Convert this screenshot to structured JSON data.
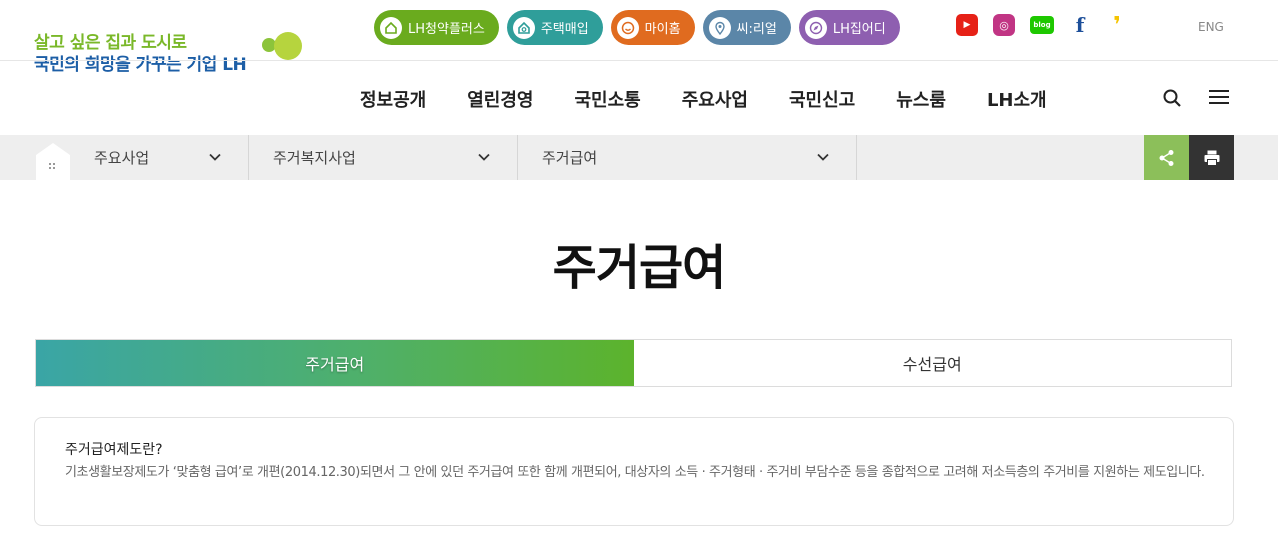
{
  "logo": {
    "line1": "살고 싶은 집과 도시로",
    "line2": "국민의 희망을 가꾸는 기업 LH"
  },
  "quick_links": [
    {
      "label": "LH청약플러스",
      "color": "#6aab1e",
      "icon": "home-icon"
    },
    {
      "label": "주택매입",
      "color": "#2f9e9a",
      "icon": "house-search-icon"
    },
    {
      "label": "마이홈",
      "color": "#e06b1f",
      "icon": "smile-icon"
    },
    {
      "label": "씨:리얼",
      "color": "#5b86a8",
      "icon": "location-pin-icon"
    },
    {
      "label": "LH집어디",
      "color": "#8e5fb0",
      "icon": "compass-icon"
    }
  ],
  "social": {
    "youtube": "▶",
    "instagram": "◎",
    "blog": "blog",
    "facebook": "f",
    "kakao": "❜"
  },
  "lang": "ENG",
  "gnb": [
    "정보공개",
    "열린경영",
    "국민소통",
    "주요사업",
    "국민신고",
    "뉴스룸",
    "LH소개"
  ],
  "breadcrumb": {
    "level1": "주요사업",
    "level2": "주거복지사업",
    "level3": "주거급여"
  },
  "page_title": "주거급여",
  "tabs": [
    {
      "label": "주거급여",
      "active": true
    },
    {
      "label": "수선급여",
      "active": false
    }
  ],
  "info": {
    "question": "주거급여제도란?",
    "description": "기초생활보장제도가 ‘맞춤형 급여’로 개편(2014.12.30)되면서 그 안에 있던 주거급여 또한 함께 개편되어, 대상자의 소득 · 주거형태 · 주거비 부담수준 등을 종합적으로 고려해 저소득층의 주거비를 지원하는 제도입니다."
  }
}
